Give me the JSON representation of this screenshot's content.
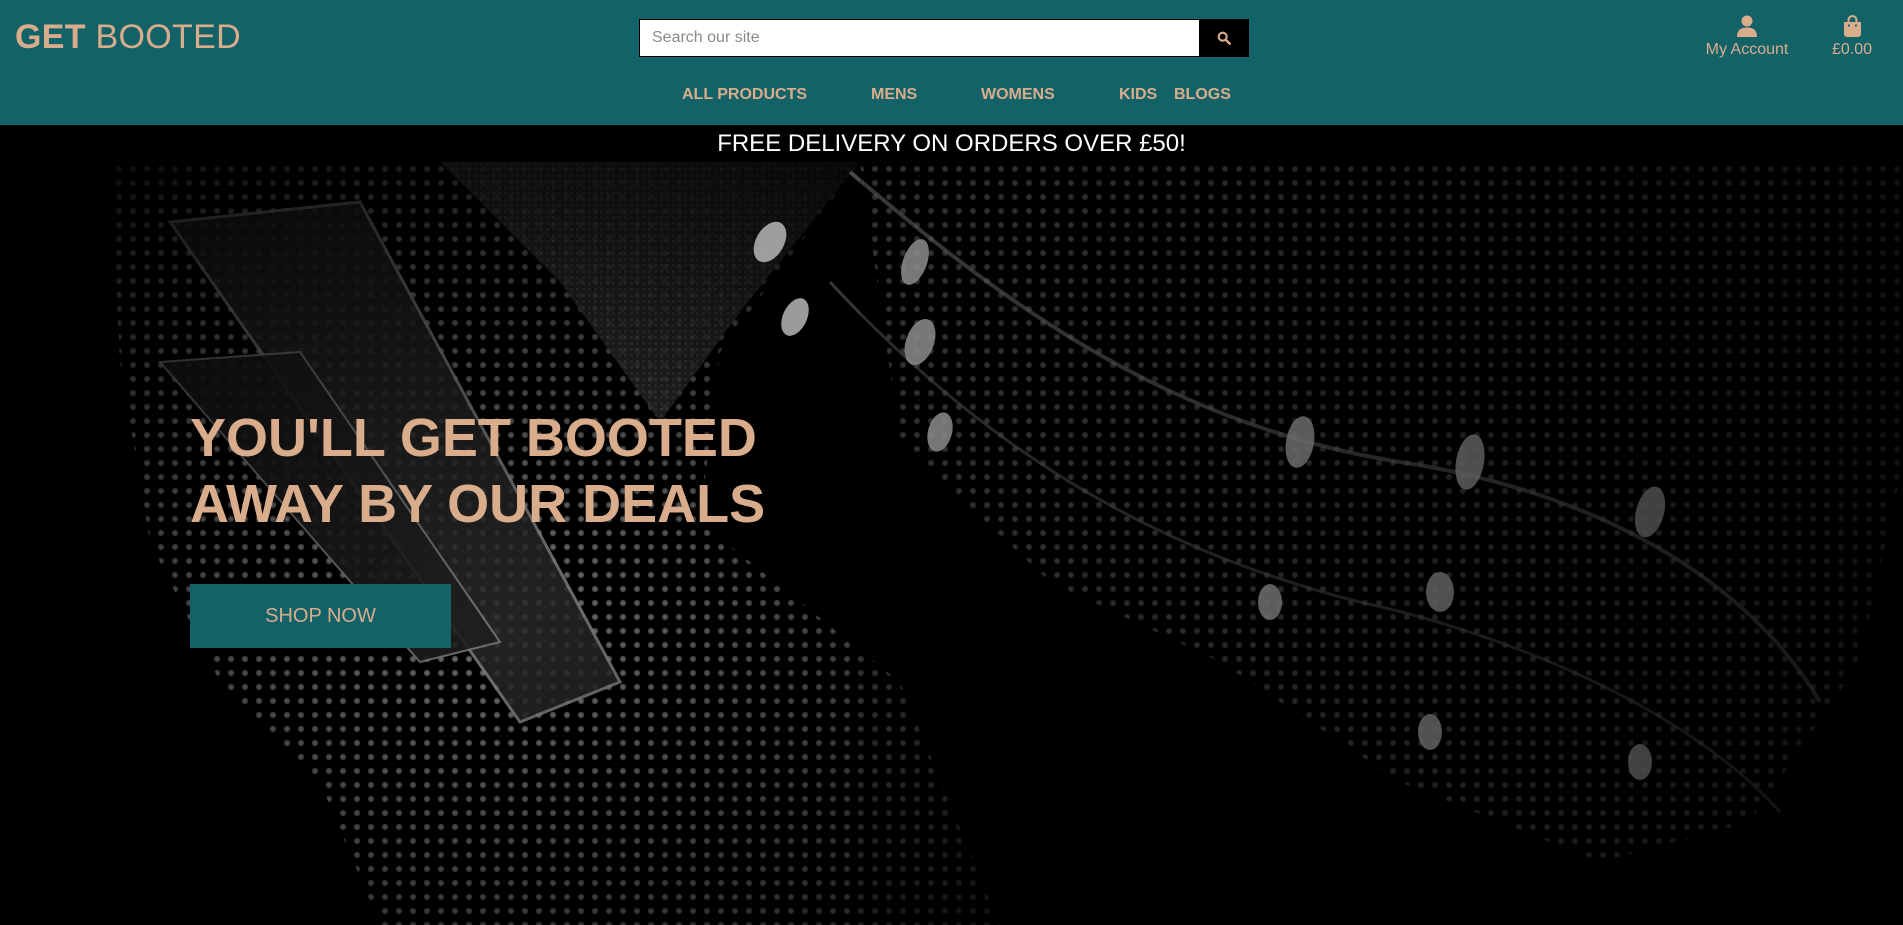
{
  "brand": {
    "bold": "GET",
    "light": "BOOTED"
  },
  "search": {
    "placeholder": "Search our site",
    "value": "",
    "icon": "search-icon"
  },
  "account": {
    "label": "My Account",
    "icon": "user-icon"
  },
  "cart": {
    "total": "£0.00",
    "icon": "shopping-bag-icon"
  },
  "nav": {
    "items": [
      {
        "label": "ALL PRODUCTS"
      },
      {
        "label": "MENS"
      },
      {
        "label": "WOMENS"
      },
      {
        "label": "KIDS"
      },
      {
        "label": "BLOGS"
      }
    ]
  },
  "banner": {
    "text": "FREE DELIVERY ON ORDERS OVER £50!"
  },
  "hero": {
    "headline_line1": "YOU'LL GET BOOTED",
    "headline_line2": "AWAY BY OUR DEALS",
    "cta_label": "SHOP NOW",
    "image": "football-boot-photo"
  },
  "colors": {
    "header_bg": "#136268",
    "accent": "#d9ad8c",
    "banner_bg": "#000000",
    "banner_text": "#ffffff"
  }
}
